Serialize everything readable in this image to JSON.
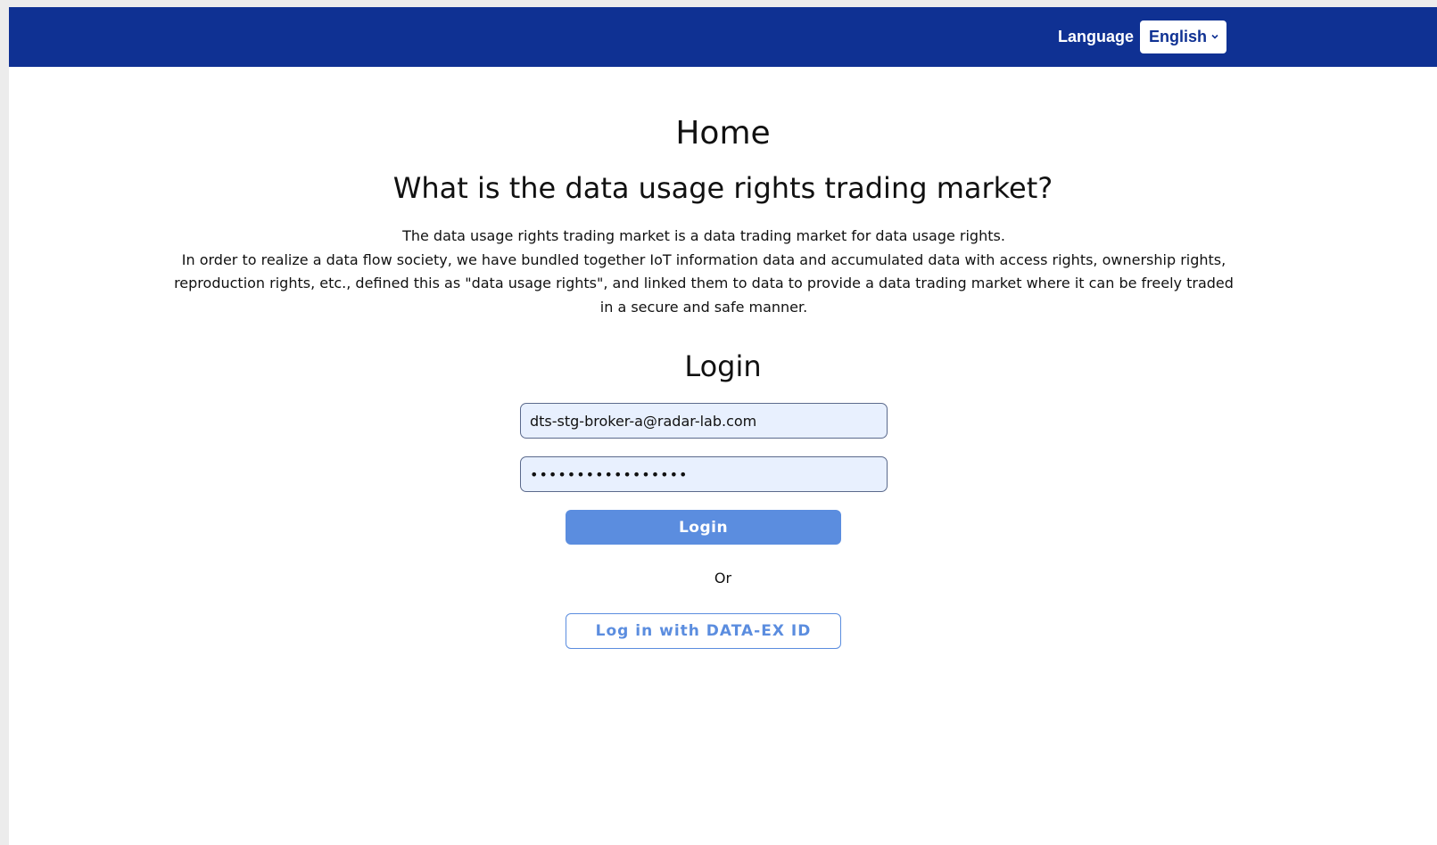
{
  "header": {
    "language_label": "Language",
    "language_selected": "English",
    "bg_color": "#0f3193"
  },
  "main": {
    "page_title": "Home",
    "about_heading": "What is the data usage rights trading market?",
    "description_lines": [
      "The data usage rights trading market is a data trading market for data usage rights.",
      "In order to realize a data flow society, we have bundled together IoT information data and accumulated data with access rights, ownership rights,",
      "reproduction rights, etc., defined this as \"data usage rights\", and linked them to data to provide a data trading market where it can be freely traded",
      "in a secure and safe manner."
    ]
  },
  "login": {
    "heading": "Login",
    "email_value": "dts-stg-broker-a@radar-lab.com",
    "password_masked": "•••••••••••••••••",
    "login_button": "Login",
    "or_text": "Or",
    "dataex_button": "Log in with DATA-EX ID",
    "accent_color": "#5b8ddf"
  },
  "icons": {
    "language_dropdown": "chevron-down-icon"
  }
}
